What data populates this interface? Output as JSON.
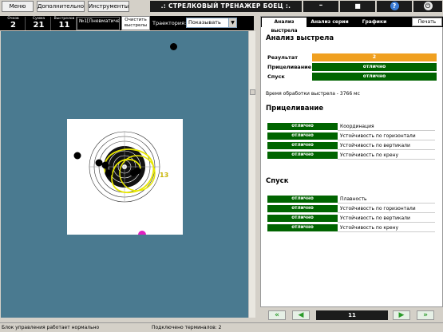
{
  "toolbar": {
    "menu_label": "Меню",
    "additional_label": "Дополнительно",
    "tools_label": "Инструменты",
    "title": ".: СТРЕЛКОВЫЙ ТРЕНАЖЕР БОЕЦ :.",
    "minimize_label": "–",
    "maximize_label": "■",
    "help_label": "?",
    "power_label": "⏻"
  },
  "stats": {
    "points_label": "Очков",
    "points_value": "2",
    "sum_label": "Сумма",
    "sum_value": "21",
    "shots_label": "Выстрелов",
    "shots_value": "11",
    "weapon": "№1[Пневматическ"
  },
  "controls": {
    "clear_label_1": "Очистить",
    "clear_label_2": "выстрелы",
    "trajectory_label": "Траектория:",
    "trajectory_value": "Показывать"
  },
  "target": {
    "hit_label": "13"
  },
  "panel": {
    "tabs": [
      "Анализ выстрела",
      "Анализ серии",
      "Графики"
    ],
    "print_label": "Печать",
    "analysis_title": "Анализ выстрела",
    "result_rows": [
      {
        "key": "Результат",
        "value": "2",
        "color": "#f0a020"
      },
      {
        "key": "Прицеливание",
        "value": "отлично",
        "color": "#006400"
      },
      {
        "key": "Спуск",
        "value": "отлично",
        "color": "#006400"
      }
    ],
    "processing_time": "Время обработки выстрела - 3766 мс",
    "aiming_title": "Прицеливание",
    "aiming_rows": [
      {
        "badge": "отлично",
        "name": "Координация"
      },
      {
        "badge": "отлично",
        "name": "Устойчивость по горизонтали"
      },
      {
        "badge": "отлично",
        "name": "Устойчивость по вертикали"
      },
      {
        "badge": "отлично",
        "name": "Устойчивость по крену"
      }
    ],
    "trigger_title": "Спуск",
    "trigger_rows": [
      {
        "badge": "отлично",
        "name": "Плавность"
      },
      {
        "badge": "отлично",
        "name": "Устойчивость по горизонтали"
      },
      {
        "badge": "отлично",
        "name": "Устойчивость по вертикали"
      },
      {
        "badge": "отлично",
        "name": "Устойчивость по крену"
      }
    ]
  },
  "nav": {
    "page": "11"
  },
  "status": {
    "left": "Блок управления работает нормально",
    "middle": "Подключено терминалов: 2"
  },
  "colors": {
    "field": "#4a7a90",
    "accent_green": "#006400",
    "accent_orange": "#f0a020"
  }
}
